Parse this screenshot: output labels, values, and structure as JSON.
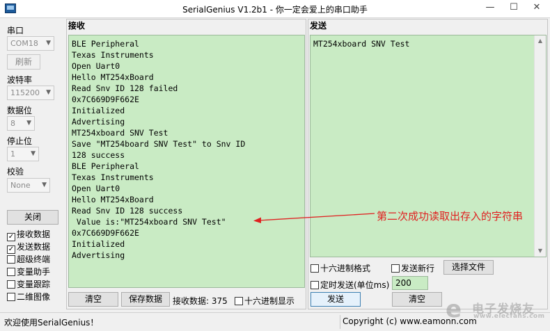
{
  "window": {
    "title": "SerialGenius V1.2b1 - 你一定会爱上的串口助手",
    "minimize": "—",
    "maximize": "☐",
    "close": "✕"
  },
  "sidebar": {
    "port_label": "串口",
    "port_value": "COM18",
    "refresh_label": "刷新",
    "baud_label": "波特率",
    "baud_value": "115200",
    "databits_label": "数据位",
    "databits_value": "8",
    "stopbits_label": "停止位",
    "stopbits_value": "1",
    "parity_label": "校验",
    "parity_value": "None",
    "close_label": "关闭",
    "checkboxes": [
      {
        "label": "接收数据",
        "checked": true
      },
      {
        "label": "发送数据",
        "checked": true
      },
      {
        "label": "超级终端",
        "checked": false
      },
      {
        "label": "变量助手",
        "checked": false
      },
      {
        "label": "变量跟踪",
        "checked": false
      },
      {
        "label": "二维图像",
        "checked": false
      }
    ]
  },
  "receive": {
    "title": "接收",
    "content": "BLE Peripheral\nTexas Instruments\nOpen Uart0\nHello MT254xBoard\nRead Snv ID 128 failed\n0x7C669D9F662E\nInitialized\nAdvertising\nMT254xboard SNV Test\nSave \"MT254board SNV Test\" to Snv ID\n128 success\nBLE Peripheral\nTexas Instruments\nOpen Uart0\nHello MT254xBoard\nRead Snv ID 128 success\n Value is:\"MT254xboard SNV Test\"\n0x7C669D9F662E\nInitialized\nAdvertising",
    "clear_label": "清空",
    "save_label": "保存数据",
    "count_label": "接收数据: 375",
    "hex_label": "十六进制显示"
  },
  "send": {
    "title": "发送",
    "content": "MT254xboard SNV Test",
    "hex_format_label": "十六进制格式",
    "newline_label": "发送新行",
    "choose_file_label": "选择文件",
    "timed_label": "定时发送(单位ms)",
    "interval_value": "200",
    "send_label": "发送",
    "clear_label": "清空"
  },
  "annotation": {
    "text": "第二次成功读取出存入的字符串",
    "color": "#e02020"
  },
  "status": {
    "left": "欢迎使用SerialGenius！",
    "right": "Copyright (c) www.eamonn.com"
  },
  "watermark": {
    "glyph": "e",
    "line1": "电子发烧友",
    "line2": "www.elecfans.com"
  }
}
